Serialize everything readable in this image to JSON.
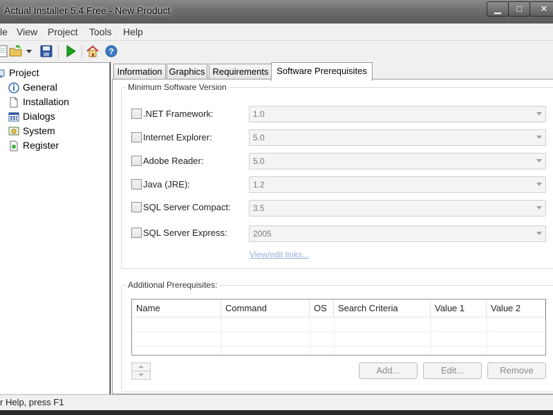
{
  "window": {
    "title": "Actual Installer 5.4 Free - New Product",
    "minimize_glyph": "▁",
    "maximize_glyph": "□",
    "close_glyph": "✕"
  },
  "menu": [
    "le",
    "View",
    "Project",
    "Tools",
    "Help"
  ],
  "toolbar": {
    "icons": [
      "new-icon",
      "open-folder-icon",
      "dropdown-arrow-icon",
      "save-icon",
      "run-icon",
      "home-icon",
      "help-icon"
    ]
  },
  "tree": {
    "root": "Project",
    "items": [
      {
        "label": "General",
        "icon": "info-icon",
        "selected": true
      },
      {
        "label": "Installation",
        "icon": "document-icon",
        "selected": false
      },
      {
        "label": "Dialogs",
        "icon": "dialogs-icon",
        "selected": false
      },
      {
        "label": "System",
        "icon": "system-icon",
        "selected": false
      },
      {
        "label": "Register",
        "icon": "register-icon",
        "selected": false
      }
    ]
  },
  "tabs": [
    {
      "label": "Information",
      "active": false
    },
    {
      "label": "Graphics",
      "active": false
    },
    {
      "label": "Requirements",
      "active": false
    },
    {
      "label": "Software Prerequisites",
      "active": true
    }
  ],
  "min_version_group": {
    "legend": "Minimum Software Version",
    "rows": [
      {
        "label": ".NET Framework:",
        "value": "1.0",
        "checked": false
      },
      {
        "label": "Internet Explorer:",
        "value": "5.0",
        "checked": false
      },
      {
        "label": "Adobe Reader:",
        "value": "5.0",
        "checked": false
      },
      {
        "label": "Java (JRE):",
        "value": "1.2",
        "checked": false
      },
      {
        "label": "SQL Server Compact:",
        "value": "3.5",
        "checked": false
      },
      {
        "label": "SQL Server Express:",
        "value": "2005",
        "checked": false
      }
    ],
    "link": "View/edit links..."
  },
  "additional_group": {
    "legend": "Additional Prerequisites:",
    "columns": [
      "Name",
      "Command",
      "OS",
      "Search Criteria",
      "Value 1",
      "Value 2"
    ],
    "buttons": {
      "add": "Add...",
      "edit": "Edit...",
      "remove": "Remove"
    }
  },
  "status": {
    "text": "r Help, press F1"
  },
  "colors": {
    "accent": "#3d7bc8",
    "link": "#98aed5",
    "run": "#1aa31a"
  }
}
